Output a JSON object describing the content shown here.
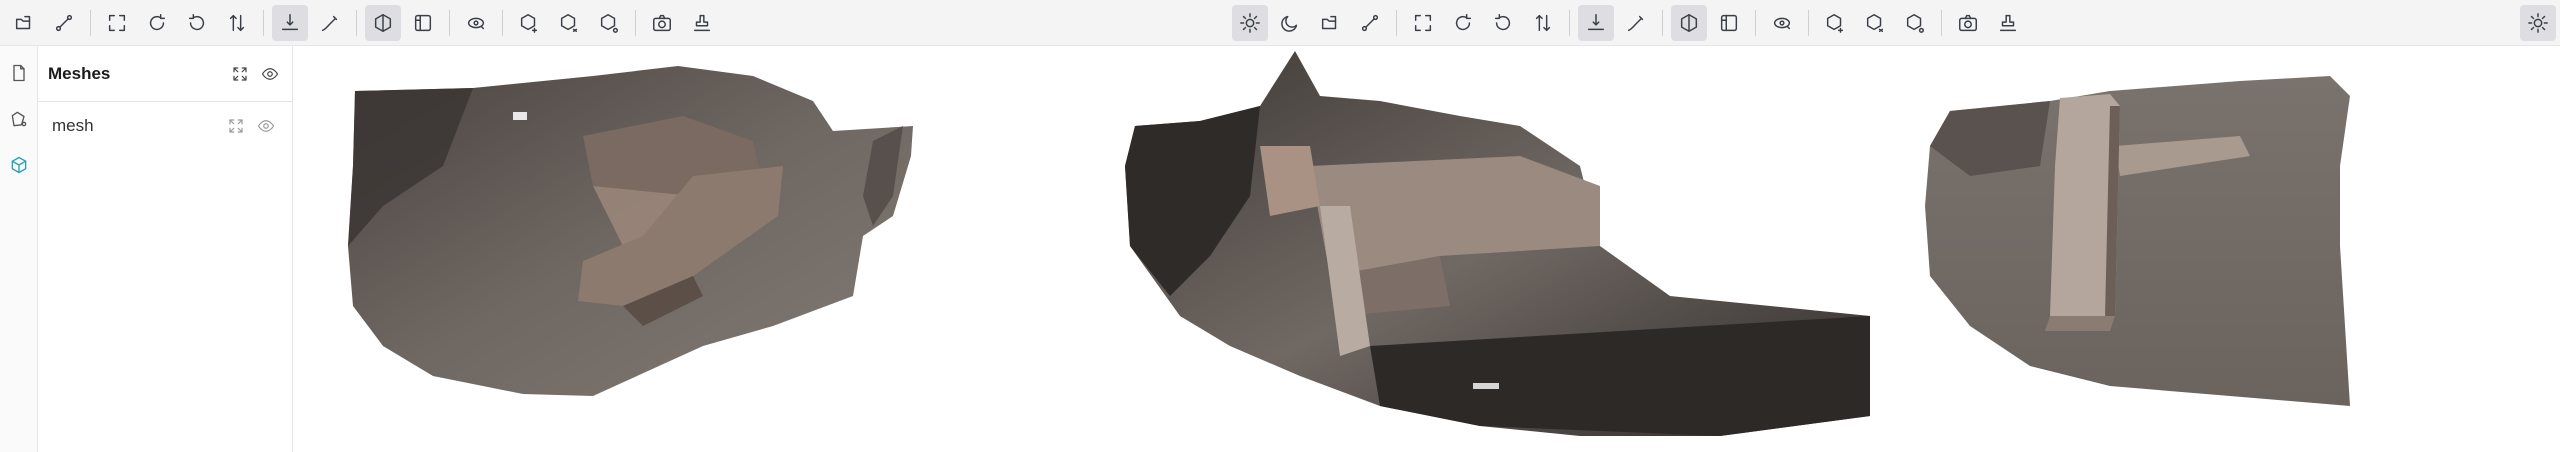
{
  "panel": {
    "title": "Meshes",
    "items": [
      {
        "label": "mesh"
      }
    ]
  },
  "icons": {
    "toolbar_left": [
      "import-icon",
      "measure-icon",
      "fit-view-icon",
      "rotate-x-icon",
      "rotate-y-icon",
      "flip-icon",
      "ground-icon",
      "draw-icon",
      "shading-icon",
      "ortho-icon",
      "camera-orbit-icon",
      "add-object-icon",
      "add-object-alt-icon",
      "add-object-more-icon",
      "screenshot-icon",
      "stamp-icon"
    ],
    "toolbar_mid": [
      "sun-icon",
      "moon-icon",
      "import-icon",
      "measure-icon",
      "fit-view-icon",
      "rotate-x-icon",
      "rotate-y-icon",
      "flip-icon",
      "ground-icon",
      "draw-icon",
      "shading-icon",
      "ortho-icon",
      "camera-orbit-icon",
      "add-object-icon",
      "add-object-alt-icon",
      "add-object-more-icon",
      "screenshot-icon",
      "stamp-icon"
    ],
    "toolbar_right": [
      "sun-icon"
    ],
    "rail": [
      "file-icon",
      "shapes-icon",
      "cube-icon"
    ]
  },
  "colors": {
    "accent": "#2aa0b8",
    "toolbar_bg": "#f4f4f5",
    "active_button": "#dedee2"
  }
}
